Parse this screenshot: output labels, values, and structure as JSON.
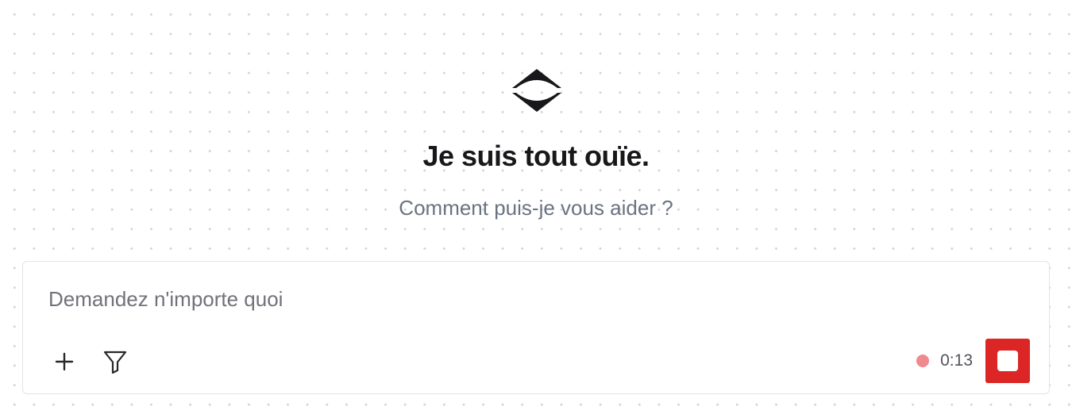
{
  "hero": {
    "logo_icon": "diamond-logo-icon",
    "title": "Je suis tout ouïe.",
    "subtitle": "Comment puis-je vous aider ?"
  },
  "composer": {
    "input_value": "",
    "input_placeholder": "Demandez n'importe quoi",
    "add_icon": "plus-icon",
    "filter_icon": "filter-icon",
    "recording_dot_color": "#f08a8f",
    "recording_time": "0:13",
    "stop_button_color": "#dc2626",
    "stop_icon": "stop-icon"
  },
  "colors": {
    "title": "#18181b",
    "subtitle": "#6b7280",
    "border": "#e4e4e7",
    "dot_grid": "#d4d4d8"
  }
}
